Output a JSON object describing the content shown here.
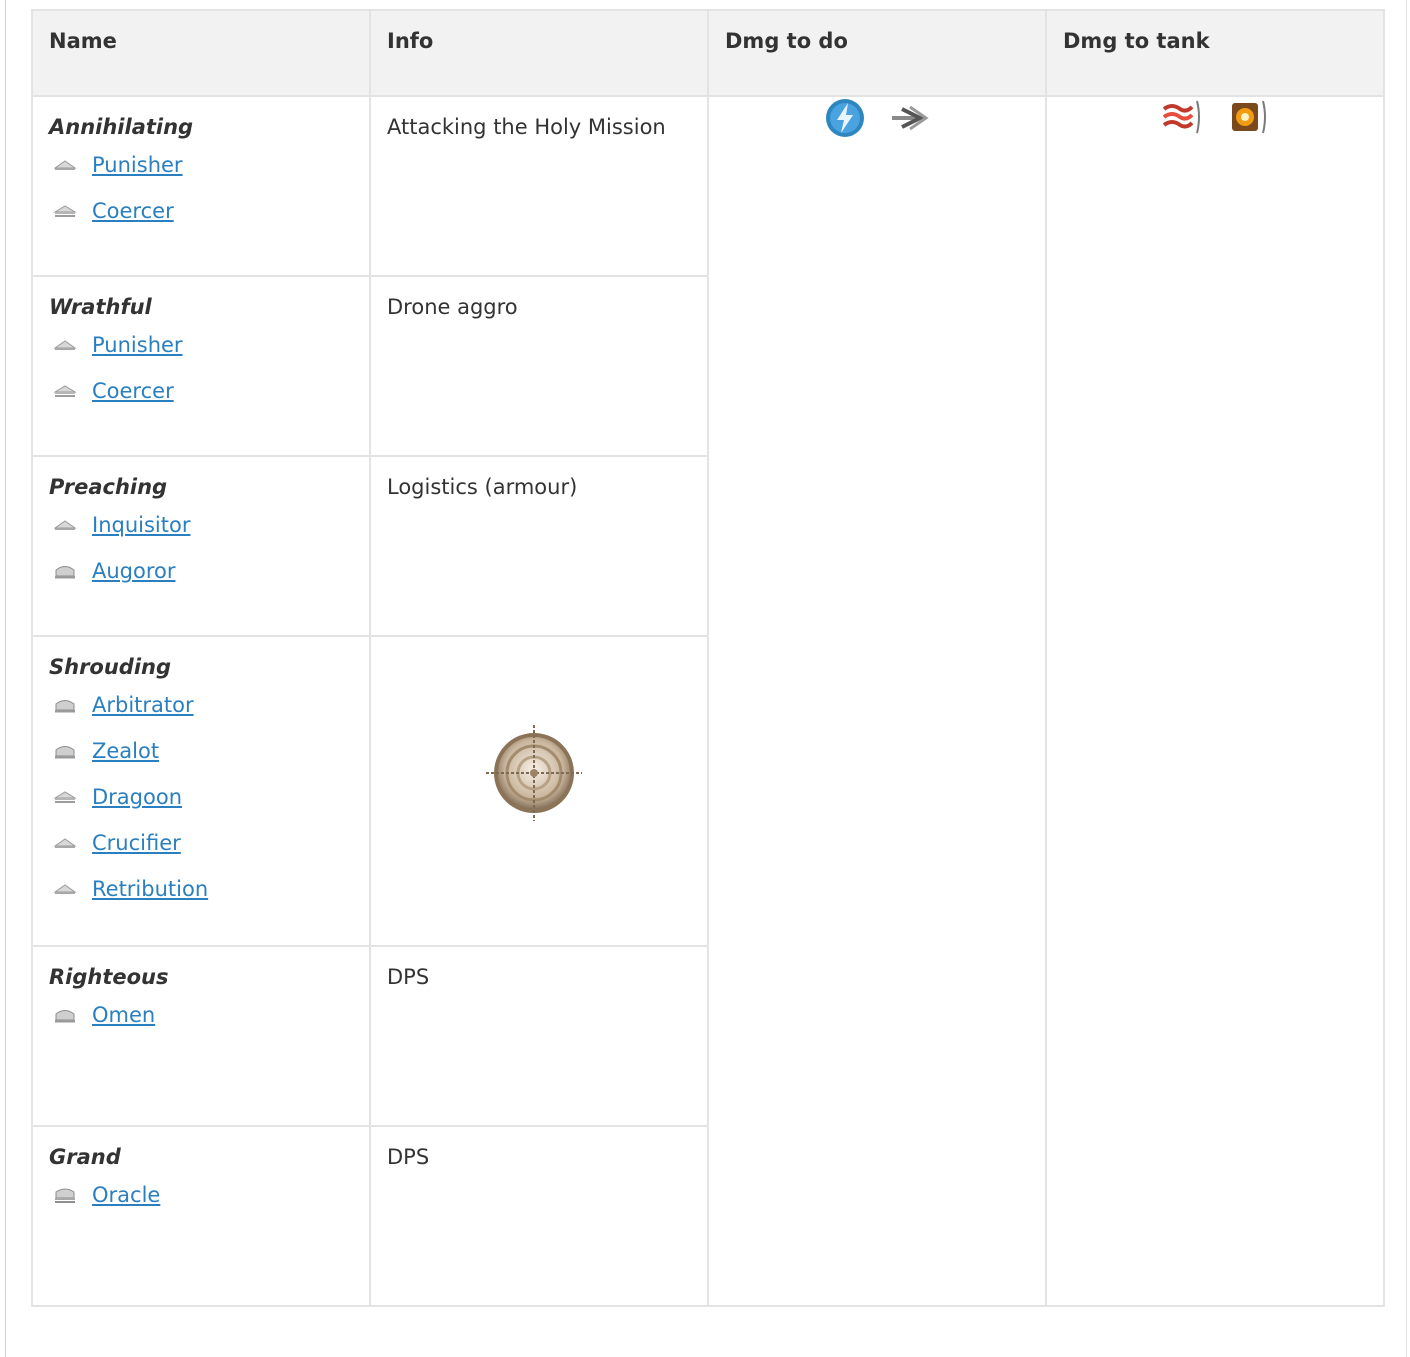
{
  "table": {
    "headers": {
      "name": "Name",
      "info": "Info",
      "dmg_to_do": "Dmg to do",
      "dmg_to_tank": "Dmg to tank"
    },
    "groups": [
      {
        "title": "Annihilating",
        "info": "Attacking the Holy Mission",
        "ships": [
          {
            "name": "Punisher",
            "icon": "frigate-icon"
          },
          {
            "name": "Coercer",
            "icon": "destroyer-icon"
          }
        ]
      },
      {
        "title": "Wrathful",
        "info": "Drone aggro",
        "ships": [
          {
            "name": "Punisher",
            "icon": "frigate-icon"
          },
          {
            "name": "Coercer",
            "icon": "destroyer-icon"
          }
        ]
      },
      {
        "title": "Preaching",
        "info": "Logistics (armour)",
        "ships": [
          {
            "name": "Inquisitor",
            "icon": "frigate-icon"
          },
          {
            "name": "Augoror",
            "icon": "cruiser-icon"
          }
        ]
      },
      {
        "title": "Shrouding",
        "info": "",
        "info_icon": "target-painter-icon",
        "ships": [
          {
            "name": "Arbitrator",
            "icon": "cruiser-icon"
          },
          {
            "name": "Zealot",
            "icon": "cruiser-icon"
          },
          {
            "name": "Dragoon",
            "icon": "destroyer-icon"
          },
          {
            "name": "Crucifier",
            "icon": "frigate-icon"
          },
          {
            "name": "Retribution",
            "icon": "frigate-icon"
          }
        ]
      },
      {
        "title": "Righteous",
        "info": "DPS",
        "ships": [
          {
            "name": "Omen",
            "icon": "cruiser-icon"
          }
        ]
      },
      {
        "title": "Grand",
        "info": "DPS",
        "ships": [
          {
            "name": "Oracle",
            "icon": "battlecruiser-icon"
          }
        ]
      }
    ],
    "dmg_to_do_icons": [
      "em-damage-icon",
      "kinetic-damage-icon"
    ],
    "dmg_to_tank_icons": [
      "thermal-resist-icon",
      "explosive-resist-icon"
    ]
  },
  "colors": {
    "link": "#2a7fc1",
    "border": "#e3e3e3",
    "header_bg": "#f2f2f2",
    "text": "#333333"
  }
}
